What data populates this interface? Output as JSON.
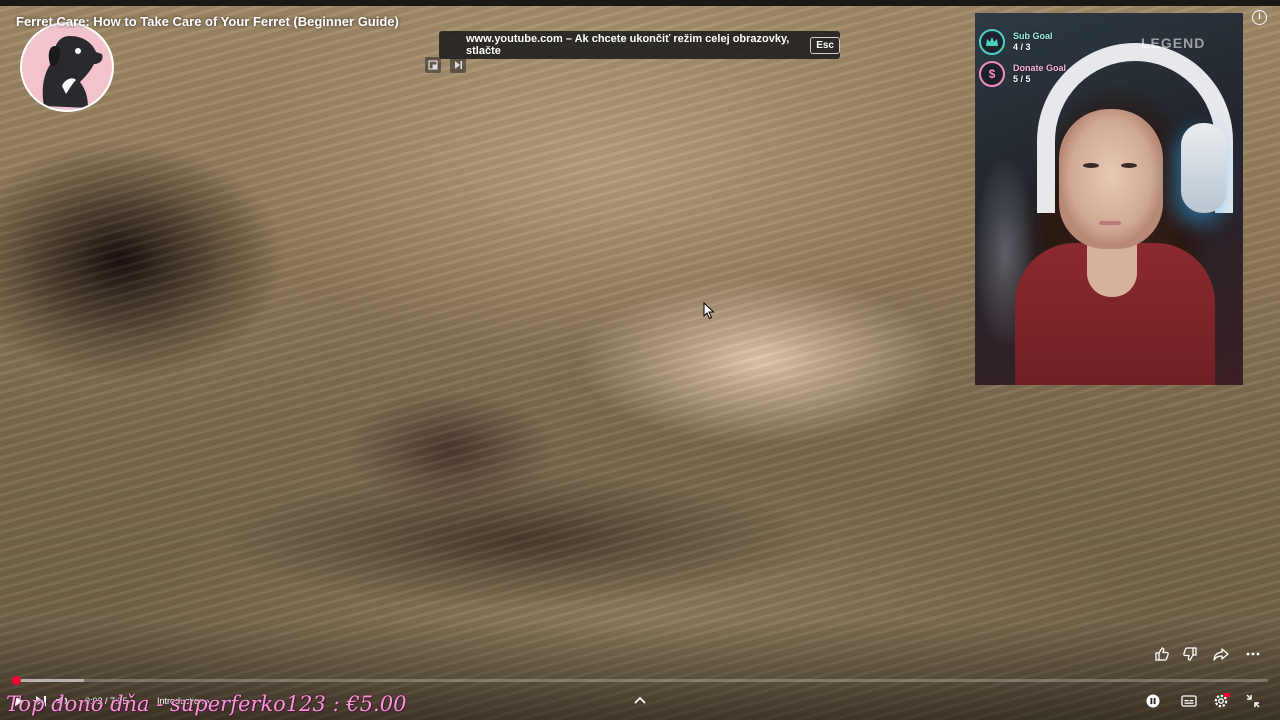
{
  "video": {
    "title": "Ferret Care: How to Take Care of Your Ferret (Beginner Guide)"
  },
  "fullscreen_notice": {
    "message": "www.youtube.com – Ak chcete ukončiť režim celej obrazovky, stlačte",
    "key": "Esc"
  },
  "stream_overlay": {
    "sub_goal": {
      "label": "Sub Goal",
      "value": "4 / 3",
      "icon": "crown-icon",
      "color": "#4fd1c5"
    },
    "donate_goal": {
      "label": "Donate Goal",
      "value": "5 / 5",
      "icon": "dollar-icon",
      "color": "#f38ec5"
    },
    "headset_brand": "LEGEND",
    "top_donor": "Top dono dňa - superferko123 : €5.00"
  },
  "player": {
    "current_time": "0:02",
    "duration": "/ 7:25",
    "chapter": "Introduction",
    "progress_played": 0.003,
    "progress_loaded": 0.057,
    "accent": "#ff0033",
    "controls_left": [
      "play-icon",
      "next-icon",
      "volume-icon"
    ],
    "controls_right": [
      "autoplay-toggle-icon",
      "subtitles-icon",
      "settings-icon",
      "exit-fullscreen-icon"
    ],
    "actions": [
      "like-icon",
      "dislike-icon",
      "share-icon",
      "more-icon"
    ]
  }
}
